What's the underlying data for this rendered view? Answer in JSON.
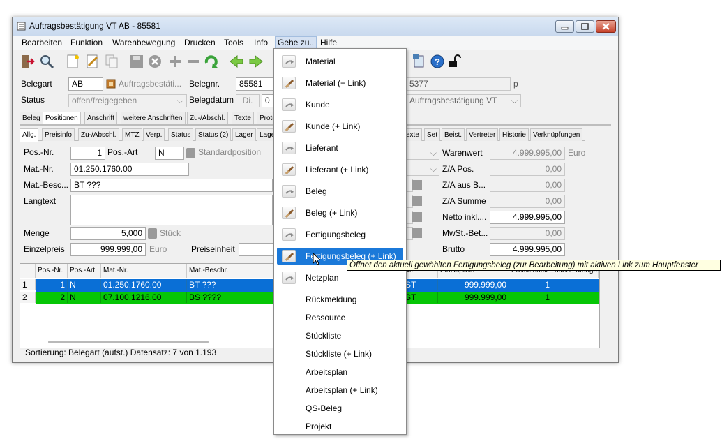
{
  "window": {
    "title": "Auftragsbestätigung VT AB - 85581"
  },
  "menu": [
    "Bearbeiten",
    "Funktion",
    "Warenbewegung",
    "Drucken",
    "Tools",
    "Info",
    "Gehe zu..",
    "Hilfe"
  ],
  "header": {
    "belegart_label": "Belegart",
    "belegart_value": "AB",
    "belegart_text": "Auftragsbestäti...",
    "belegnr_label": "Belegnr.",
    "belegnr_value": "85581",
    "right_value_1": "5377",
    "right_suffix_1": "p",
    "status_label": "Status",
    "status_value": "offen/freigegeben",
    "belegdatum_label": "Belegdatum",
    "belegdatum_day": "Di.",
    "belegdatum_value": "0",
    "right_value_2": "Auftragsbestätigung VT"
  },
  "tabs_top": [
    "Beleg",
    "Positionen",
    "Anschrift",
    "weitere Anschriften",
    "Zu-/Abschl.",
    "Texte",
    "Proto"
  ],
  "tabs_sub_left": [
    "Allg.",
    "Preisinfo",
    "Zu-/Abschl.",
    "MTZ",
    "Verp.",
    "Status",
    "Status (2)",
    "Lager",
    "Lage"
  ],
  "tabs_sub_right": [
    "exte",
    "Set",
    "Beist.",
    "Vertreter",
    "Historie",
    "Verknüpfungen"
  ],
  "position": {
    "posnr_label": "Pos.-Nr.",
    "posnr_value": "1",
    "posart_label": "Pos.-Art",
    "posart_value": "N",
    "posart_text": "Standardposition",
    "matnr_label": "Mat.-Nr.",
    "matnr_value": "01.250.1760.00",
    "matbesc_label": "Mat.-Besc...",
    "matbesc_value": "BT ???",
    "langtext_label": "Langtext",
    "menge_label": "Menge",
    "menge_value": "5,000",
    "menge_unit": "Stück",
    "einzelpreis_label": "Einzelpreis",
    "einzelpreis_value": "999.999,00",
    "einzelpreis_currency": "Euro",
    "preiseinheit_label": "Preiseinheit"
  },
  "totals": [
    {
      "label": "Warenwert",
      "value": "4.999.995,00",
      "unit": "Euro"
    },
    {
      "label": "Z/A Pos.",
      "value": "0,00",
      "unit": ""
    },
    {
      "label": "Z/A aus B...",
      "value": "0,00",
      "unit": ""
    },
    {
      "label": "Z/A Summe",
      "value": "0,00",
      "unit": ""
    },
    {
      "label": "Netto inkl....",
      "value": "4.999.995,00",
      "unit": ""
    },
    {
      "label": "MwSt.-Bet...",
      "value": "0,00",
      "unit": ""
    },
    {
      "label": "Brutto",
      "value": "4.999.995,00",
      "unit": ""
    }
  ],
  "grid": {
    "headers": [
      "Pos.-Nr.",
      "Pos.-Art",
      "Mat.-Nr.",
      "Mat.-Beschr.",
      "ME",
      "Einzelpreis",
      "Preiseinheit",
      "offene Menge"
    ],
    "rows": [
      {
        "idx": "1",
        "posnr": "1",
        "posart": "N",
        "matnr": "01.250.1760.00",
        "matbeschr": "BT ???",
        "me": "ST",
        "einzelpreis": "999.999,00",
        "preiseinheit": "1"
      },
      {
        "idx": "2",
        "posnr": "2",
        "posart": "N",
        "matnr": "07.100.1216.00",
        "matbeschr": "BS ????",
        "me": "ST",
        "einzelpreis": "999.999,00",
        "preiseinheit": "1"
      }
    ],
    "row_colors": {
      "selected": "#0a6fd6",
      "green": "#06c606"
    }
  },
  "status_bar": "Sortierung: Belegart (aufst.) Datensatz: 7 von 1.193",
  "dropdown": [
    {
      "label": "Material",
      "icon": "link-icon"
    },
    {
      "label": "Material (+ Link)",
      "icon": "edit-link-icon"
    },
    {
      "label": "Kunde",
      "icon": "link-icon"
    },
    {
      "label": "Kunde (+ Link)",
      "icon": "edit-link-icon"
    },
    {
      "label": "Lieferant",
      "icon": "link-icon"
    },
    {
      "label": "Lieferant (+ Link)",
      "icon": "edit-link-icon"
    },
    {
      "label": "Beleg",
      "icon": "link-icon"
    },
    {
      "label": "Beleg (+ Link)",
      "icon": "edit-link-icon"
    },
    {
      "label": "Fertigungsbeleg",
      "icon": "link-icon"
    },
    {
      "label": "Fertigungsbeleg (+ Link)",
      "icon": "edit-link-icon"
    },
    {
      "label": "Netzplan",
      "icon": "link-icon"
    },
    {
      "label": "Rückmeldung",
      "icon": ""
    },
    {
      "label": "Ressource",
      "icon": ""
    },
    {
      "label": "Stückliste",
      "icon": ""
    },
    {
      "label": "Stückliste (+ Link)",
      "icon": ""
    },
    {
      "label": "Arbeitsplan",
      "icon": ""
    },
    {
      "label": "Arbeitsplan (+ Link)",
      "icon": ""
    },
    {
      "label": "QS-Beleg",
      "icon": ""
    },
    {
      "label": "Projekt",
      "icon": ""
    }
  ],
  "tooltip": "Öffnet den aktuell gewählten Fertigungsbeleg (zur Bearbeitung) mit aktiven Link zum Hauptfenster"
}
